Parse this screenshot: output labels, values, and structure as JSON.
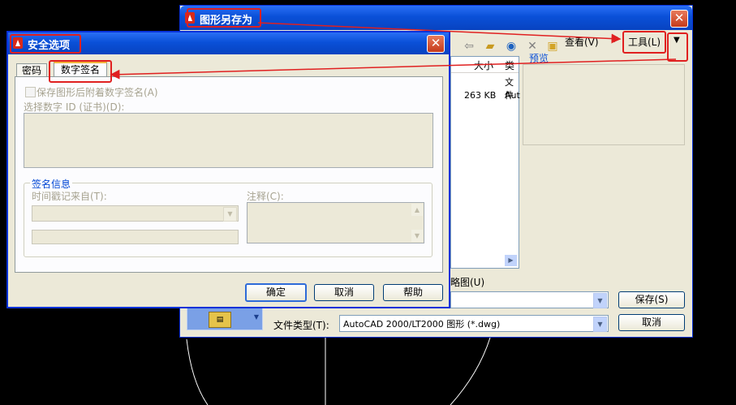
{
  "saveas": {
    "title": "图形另存为",
    "toolbar": {
      "view_label": "查看(V)",
      "tools_label": "工具(L)"
    },
    "preview_label": "预览",
    "columns": {
      "size": "大小",
      "type": "类"
    },
    "rows": [
      {
        "size": "",
        "type": "文件"
      },
      {
        "size": "263 KB",
        "type": "Aut"
      }
    ],
    "thumb_label": "略图(U)",
    "filetype_label": "文件类型(T):",
    "filetype_value": "AutoCAD 2000/LT2000 图形 (*.dwg)",
    "save_button": "保存(S)",
    "cancel_button": "取消"
  },
  "security": {
    "title": "安全选项",
    "tabs": [
      {
        "label": "密码"
      },
      {
        "label": "数字签名"
      }
    ],
    "checkbox_label": "保存图形后附着数字签名(A)",
    "select_id_label": "选择数字 ID (证书)(D):",
    "group_title": "签名信息",
    "timestamp_label": "时间戳记来自(T):",
    "comment_label": "注释(C):",
    "ok_button": "确定",
    "cancel_button": "取消",
    "help_button": "帮助"
  },
  "colors": {
    "xp_blue": "#0a50d8",
    "annotation_red": "#e02020",
    "dialog_bg": "#ece9d8"
  }
}
